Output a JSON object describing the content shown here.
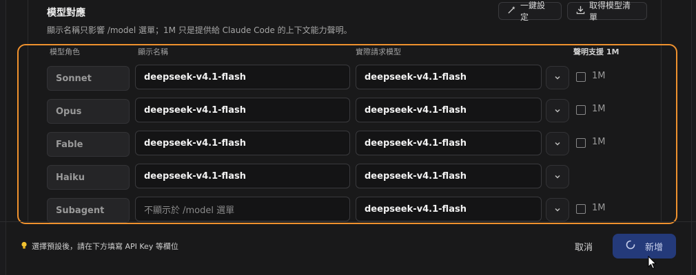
{
  "header": {
    "title": "模型對應",
    "subtitle": "顯示名稱只影響 /model 選單；1M 只是提供給 Claude Code 的上下文能力聲明。",
    "one_click_label": "一鍵設定",
    "fetch_label": "取得模型清單"
  },
  "columns": {
    "role": "模型角色",
    "display": "顯示名稱",
    "actual": "實際請求模型",
    "support": "聲明支援 1M"
  },
  "rows": [
    {
      "role": "Sonnet",
      "display": "deepseek-v4.1-flash",
      "model": "deepseek-v4.1-flash",
      "flag": "1M"
    },
    {
      "role": "Opus",
      "display": "deepseek-v4.1-flash",
      "model": "deepseek-v4.1-flash",
      "flag": "1M"
    },
    {
      "role": "Fable",
      "display": "deepseek-v4.1-flash",
      "model": "deepseek-v4.1-flash",
      "flag": "1M"
    },
    {
      "role": "Haiku",
      "display": "deepseek-v4.1-flash",
      "model": "deepseek-v4.1-flash"
    },
    {
      "role": "Subagent",
      "display_placeholder": "不顯示於 /model 選單",
      "model": "deepseek-v4.1-flash",
      "flag": "1M"
    }
  ],
  "footer": {
    "tip": "選擇預設後，請在下方填寫 API Key 等欄位",
    "cancel_label": "取消",
    "add_label": "新增"
  },
  "colors": {
    "highlight": "#f0922e",
    "primary_button": "#243a7a",
    "tip_icon": "#f2c230"
  }
}
